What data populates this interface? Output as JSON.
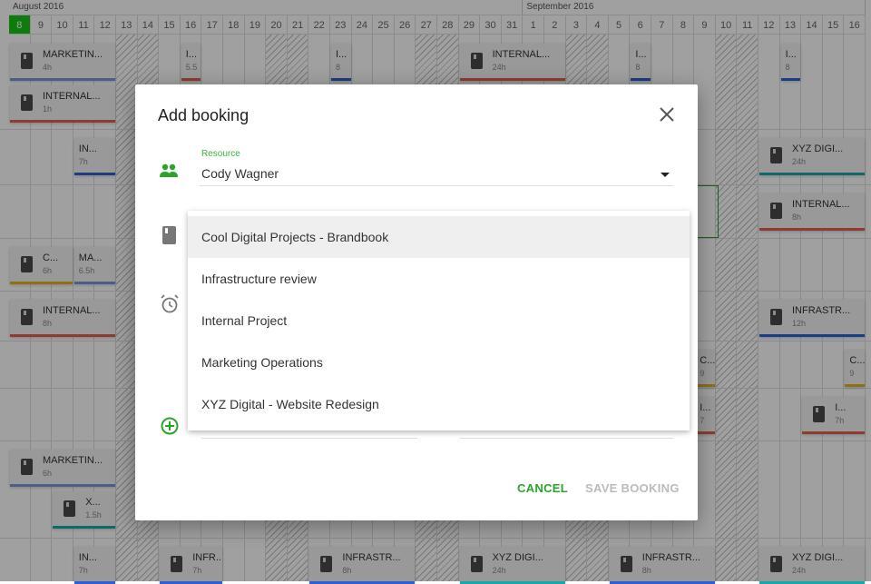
{
  "calendar": {
    "months": [
      {
        "label": "August 2016",
        "start": 0,
        "span": 24
      },
      {
        "label": "September 2016",
        "start": 24,
        "span": 16
      }
    ],
    "days": [
      "8",
      "9",
      "10",
      "11",
      "12",
      "13",
      "14",
      "15",
      "16",
      "17",
      "18",
      "19",
      "20",
      "21",
      "22",
      "23",
      "24",
      "25",
      "26",
      "27",
      "28",
      "29",
      "30",
      "31",
      "1",
      "2",
      "3",
      "4",
      "5",
      "6",
      "7",
      "8",
      "9",
      "10",
      "11",
      "12",
      "13",
      "14",
      "15",
      "16"
    ],
    "today_index": 0,
    "weekend_indices": [
      5,
      6,
      12,
      13,
      19,
      20,
      26,
      27,
      33,
      34
    ],
    "bookings": [
      {
        "title": "MARKETIN...",
        "hours": "4h",
        "row": 0,
        "lane": 0,
        "start": 0,
        "span": 5,
        "color": "#7b93d8",
        "icon": true
      },
      {
        "title": "I...",
        "hours": "5.5",
        "row": 0,
        "lane": 0,
        "start": 8,
        "span": 1,
        "color": "#e0604c",
        "icon": false
      },
      {
        "title": "I...",
        "hours": "8",
        "row": 0,
        "lane": 0,
        "start": 15,
        "span": 1,
        "color": "#2f5fd0",
        "icon": false
      },
      {
        "title": "INTERNAL...",
        "hours": "24h",
        "row": 0,
        "lane": 0,
        "start": 21,
        "span": 5,
        "color": "#e0604c",
        "icon": true
      },
      {
        "title": "I...",
        "hours": "8",
        "row": 0,
        "lane": 0,
        "start": 29,
        "span": 1,
        "color": "#2f5fd0",
        "icon": false
      },
      {
        "title": "I...",
        "hours": "8",
        "row": 0,
        "lane": 0,
        "start": 36,
        "span": 1,
        "color": "#2f5fd0",
        "icon": false
      },
      {
        "title": "INTERNAL...",
        "hours": "1h",
        "row": 0,
        "lane": 1,
        "start": 0,
        "span": 5,
        "color": "#e0604c",
        "icon": true
      },
      {
        "title": "IN...",
        "hours": "7h",
        "row": 1,
        "lane": 0,
        "start": 3,
        "span": 2,
        "color": "#2f5fd0",
        "icon": false
      },
      {
        "title": "XYZ DIGI...",
        "hours": "24h",
        "row": 1,
        "lane": 0,
        "start": 35,
        "span": 5,
        "color": "#1aa7a7",
        "icon": true
      },
      {
        "title": "INTERNAL...",
        "hours": "8h",
        "row": 2,
        "lane": 0,
        "start": 35,
        "span": 5,
        "color": "#e0604c",
        "icon": true
      },
      {
        "title": "C...",
        "hours": "6h",
        "row": 3,
        "lane": 0,
        "start": 0,
        "span": 3,
        "color": "#e0b020",
        "icon": true
      },
      {
        "title": "MA...",
        "hours": "6.5h",
        "row": 3,
        "lane": 0,
        "start": 3,
        "span": 2,
        "color": "#7b93d8",
        "icon": false
      },
      {
        "title": "INTERNAL...",
        "hours": "8h",
        "row": 4,
        "lane": 0,
        "start": 0,
        "span": 5,
        "color": "#e0604c",
        "icon": true
      },
      {
        "title": "INFRASTR...",
        "hours": "12h",
        "row": 4,
        "lane": 0,
        "start": 35,
        "span": 5,
        "color": "#2f5fd0",
        "icon": true
      },
      {
        "title": "C...",
        "hours": "9",
        "row": 5,
        "lane": 0,
        "start": 32,
        "span": 1,
        "color": "#e0b020",
        "icon": false
      },
      {
        "title": "C...",
        "hours": "9",
        "row": 5,
        "lane": 0,
        "start": 39,
        "span": 1,
        "color": "#e0b020",
        "icon": false
      },
      {
        "title": "I...",
        "hours": "7",
        "row": 6,
        "lane": 0,
        "start": 32,
        "span": 1,
        "color": "#e0604c",
        "icon": false
      },
      {
        "title": "I...",
        "hours": "7h",
        "row": 6,
        "lane": 0,
        "start": 37,
        "span": 3,
        "color": "#e0604c",
        "icon": true
      },
      {
        "title": "MARKETIN...",
        "hours": "6h",
        "row": 7,
        "lane": 0,
        "start": 0,
        "span": 5,
        "color": "#7b93d8",
        "icon": true
      },
      {
        "title": "X...",
        "hours": "1.5h",
        "row": 7,
        "lane": 1,
        "start": 2,
        "span": 3,
        "color": "#1aa7a7",
        "icon": true
      },
      {
        "title": "IN...",
        "hours": "7h",
        "row": 8,
        "lane": 0,
        "start": 3,
        "span": 2,
        "color": "#2f5fd0",
        "icon": false
      },
      {
        "title": "INFR...",
        "hours": "7h",
        "row": 8,
        "lane": 0,
        "start": 7,
        "span": 3,
        "color": "#2f5fd0",
        "icon": true
      },
      {
        "title": "INFRASTR...",
        "hours": "8h",
        "row": 8,
        "lane": 0,
        "start": 14,
        "span": 5,
        "color": "#2f5fd0",
        "icon": true
      },
      {
        "title": "XYZ DIGI...",
        "hours": "24h",
        "row": 8,
        "lane": 0,
        "start": 21,
        "span": 5,
        "color": "#1aa7a7",
        "icon": true
      },
      {
        "title": "INFRASTR...",
        "hours": "8h",
        "row": 8,
        "lane": 0,
        "start": 28,
        "span": 5,
        "color": "#2f5fd0",
        "icon": true
      },
      {
        "title": "XYZ DIGI...",
        "hours": "24h",
        "row": 8,
        "lane": 0,
        "start": 35,
        "span": 5,
        "color": "#1aa7a7",
        "icon": true
      }
    ]
  },
  "dialog": {
    "title": "Add booking",
    "resource_label": "Resource",
    "resource_value": "Cody Wagner",
    "project_options": [
      "Cool Digital Projects - Brandbook",
      "Infrastructure review",
      "Internal Project",
      "Marketing Operations",
      "XYZ Digital - Website Redesign"
    ],
    "highlighted_option": 0,
    "cancel_label": "CANCEL",
    "save_label": "SAVE BOOKING",
    "accent_color": "#2aa52a"
  }
}
